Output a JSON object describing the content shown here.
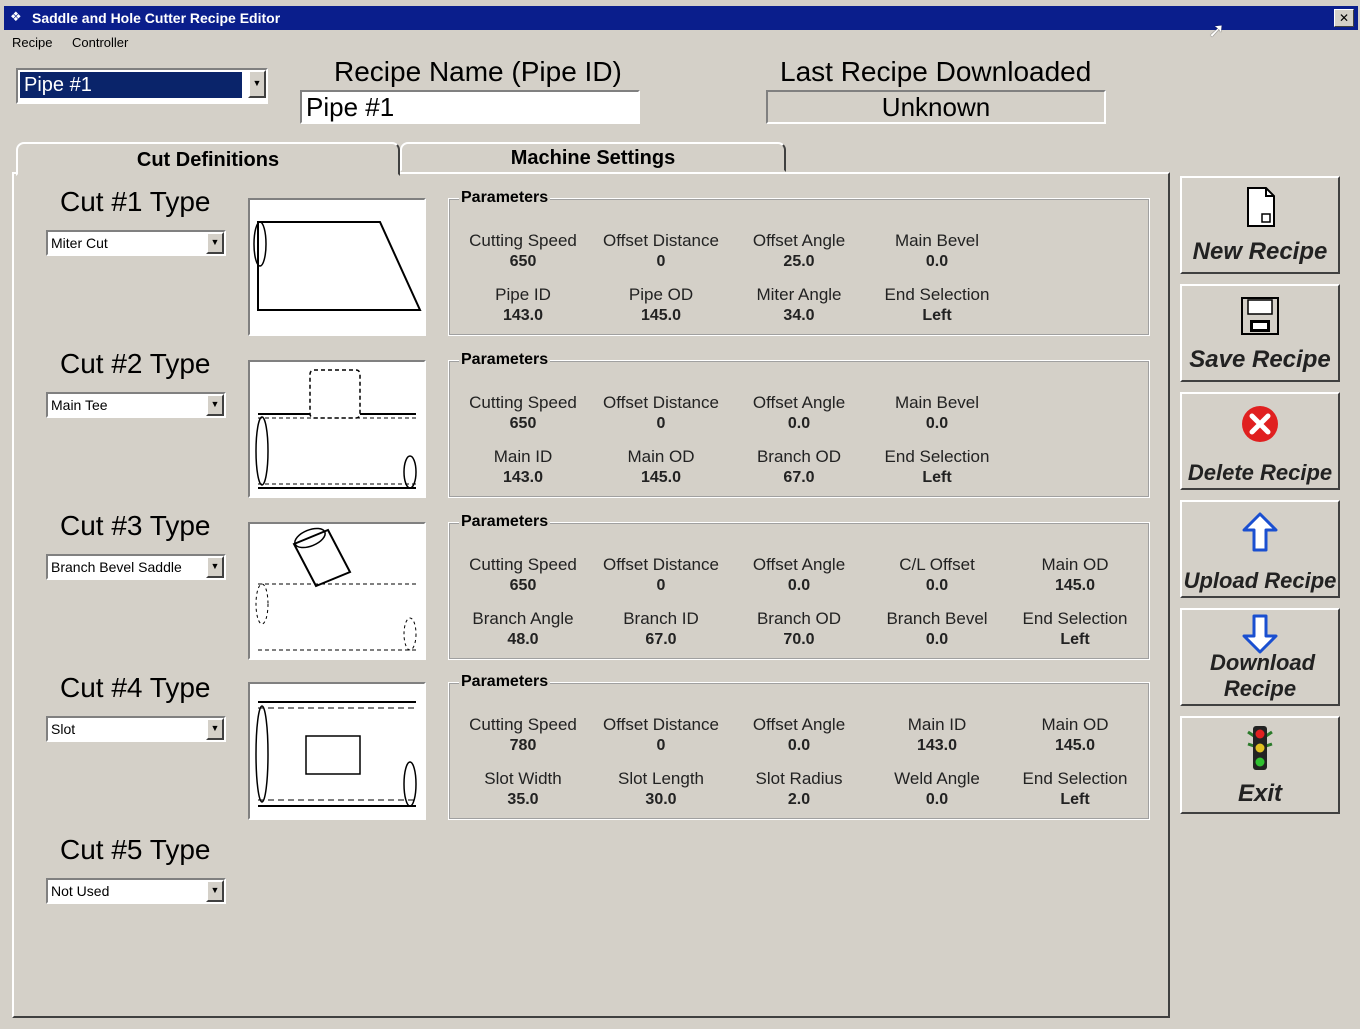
{
  "window": {
    "title": "Saddle  and Hole Cutter Recipe Editor",
    "close_glyph": "✕"
  },
  "menu": {
    "items": [
      "Recipe",
      "Controller"
    ]
  },
  "pipe_selector": {
    "value": "Pipe #1"
  },
  "recipe_name": {
    "label": "Recipe Name (Pipe ID)",
    "value": "Pipe #1"
  },
  "last_download": {
    "label": "Last Recipe Downloaded",
    "value": "Unknown"
  },
  "tabs": [
    {
      "label": "Cut Definitions",
      "active": true
    },
    {
      "label": "Machine Settings",
      "active": false
    }
  ],
  "cuts": [
    {
      "label": "Cut #1 Type",
      "type": "Miter Cut",
      "icon": "miter-cut-diagram",
      "group_title": "Parameters",
      "params": [
        {
          "name": "Cutting Speed",
          "value": "650"
        },
        {
          "name": "Offset Distance",
          "value": "0"
        },
        {
          "name": "Offset Angle",
          "value": "25.0"
        },
        {
          "name": "Main Bevel",
          "value": "0.0"
        },
        {
          "name": "Pipe ID",
          "value": "143.0"
        },
        {
          "name": "Pipe OD",
          "value": "145.0"
        },
        {
          "name": "Miter Angle",
          "value": "34.0"
        },
        {
          "name": "End Selection",
          "value": "Left"
        }
      ]
    },
    {
      "label": "Cut #2 Type",
      "type": "Main Tee",
      "icon": "main-tee-diagram",
      "group_title": "Parameters",
      "params": [
        {
          "name": "Cutting Speed",
          "value": "650"
        },
        {
          "name": "Offset Distance",
          "value": "0"
        },
        {
          "name": "Offset Angle",
          "value": "0.0"
        },
        {
          "name": "Main Bevel",
          "value": "0.0"
        },
        {
          "name": "Main ID",
          "value": "143.0"
        },
        {
          "name": "Main OD",
          "value": "145.0"
        },
        {
          "name": "Branch OD",
          "value": "67.0"
        },
        {
          "name": "End Selection",
          "value": "Left"
        }
      ]
    },
    {
      "label": "Cut #3 Type",
      "type": "Branch Bevel Saddle",
      "icon": "branch-bevel-saddle-diagram",
      "group_title": "Parameters",
      "params": [
        {
          "name": "Cutting Speed",
          "value": "650"
        },
        {
          "name": "Offset Distance",
          "value": "0"
        },
        {
          "name": "Offset Angle",
          "value": "0.0"
        },
        {
          "name": "C/L Offset",
          "value": "0.0"
        },
        {
          "name": "Main OD",
          "value": "145.0"
        },
        {
          "name": "Branch Angle",
          "value": "48.0"
        },
        {
          "name": "Branch ID",
          "value": "67.0"
        },
        {
          "name": "Branch OD",
          "value": "70.0"
        },
        {
          "name": "Branch Bevel",
          "value": "0.0"
        },
        {
          "name": "End Selection",
          "value": "Left"
        }
      ]
    },
    {
      "label": "Cut #4 Type",
      "type": "Slot",
      "icon": "slot-diagram",
      "group_title": "Parameters",
      "params": [
        {
          "name": "Cutting Speed",
          "value": "780"
        },
        {
          "name": "Offset Distance",
          "value": "0"
        },
        {
          "name": "Offset Angle",
          "value": "0.0"
        },
        {
          "name": "Main ID",
          "value": "143.0"
        },
        {
          "name": "Main OD",
          "value": "145.0"
        },
        {
          "name": "Slot Width",
          "value": "35.0"
        },
        {
          "name": "Slot Length",
          "value": "30.0"
        },
        {
          "name": "Slot Radius",
          "value": "2.0"
        },
        {
          "name": "Weld Angle",
          "value": "0.0"
        },
        {
          "name": "End Selection",
          "value": "Left"
        }
      ]
    },
    {
      "label": "Cut #5 Type",
      "type": "Not Used"
    }
  ],
  "actions": [
    {
      "label": "New Recipe",
      "icon": "new-document-icon"
    },
    {
      "label": "Save Recipe",
      "icon": "floppy-disk-icon"
    },
    {
      "label": "Delete Recipe",
      "icon": "delete-x-icon"
    },
    {
      "label": "Upload Recipe",
      "icon": "arrow-up-icon"
    },
    {
      "label": "Download Recipe",
      "icon": "arrow-down-icon"
    },
    {
      "label": "Exit",
      "icon": "traffic-light-icon"
    }
  ],
  "colors": {
    "titlebar": "#0a1e8c",
    "selection": "#0a246a",
    "face": "#d4d0c8",
    "delete_red": "#e02020",
    "arrow_blue": "#1a4fd0"
  }
}
